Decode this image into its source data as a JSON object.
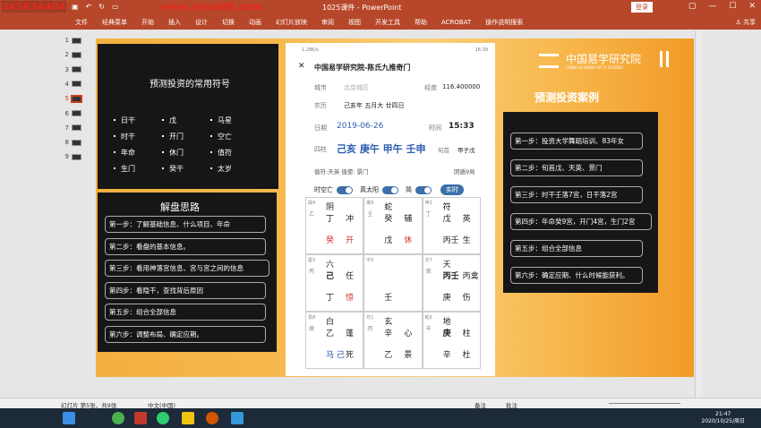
{
  "watermark": {
    "left": "345834404",
    "right": "www.yixue88.com"
  },
  "window": {
    "title": "1025课件 - PowerPoint",
    "login": "登录",
    "share": "共享"
  },
  "ribbon": [
    "文件",
    "经典菜单",
    "开始",
    "插入",
    "设计",
    "切换",
    "动画",
    "幻灯片放映",
    "审阅",
    "视图",
    "开发工具",
    "帮助",
    "ACROBAT",
    "操作说明搜索"
  ],
  "thumbs": [
    "1",
    "2",
    "3",
    "4",
    "5",
    "6",
    "7",
    "8",
    "9"
  ],
  "left_panel": {
    "title": "预测投资的常用符号",
    "symbols": [
      "日干",
      "戊",
      "马星",
      "时干",
      "开门",
      "空亡",
      "年命",
      "休门",
      "值符",
      "生门",
      "癸干",
      "太岁"
    ]
  },
  "solve": {
    "title": "解盘思路",
    "steps": [
      "第一步：了解基础信息、什么项目、年命",
      "第二步：看盘的基本信息。",
      "第三步：看用神落宫信息、宫与宫之间的信息",
      "第四步：看隐干，查找背后原因",
      "第五步：组合全部信息",
      "第六步：调整布局、确定应期。"
    ]
  },
  "phone": {
    "statusbar": "1.28K/s",
    "time": "16:39",
    "title": "中国易学研究院-陈氏九推奇门",
    "city_label": "城市",
    "city_value": "北京城区",
    "lng_label": "经度",
    "lng_value": "116.400000",
    "lunar_label": "农历",
    "lunar_value": "己亥年 五月大 廿四日",
    "date_label": "日期",
    "date_value": "2019-06-26",
    "time_label": "时间",
    "time_value": "15:33",
    "pillar_label": "四柱",
    "pillar_value": "己亥 庚午 甲午 壬申",
    "xun_label": "旬首",
    "xun_value": "甲子戊",
    "zhifu": "值符:天英 值使: 景门",
    "ju": "阴遁9局",
    "opt1": "时空亡",
    "opt2": "真太阳",
    "opt3": "简",
    "realtime": "实时",
    "grid": [
      {
        "pos": "巽4",
        "stem": "乙",
        "deity": "阴",
        "l2a": "丁",
        "l2b": "冲",
        "l3a": "癸",
        "l3b": "开"
      },
      {
        "pos": "离9",
        "stem": "壬",
        "deity": "蛇",
        "l2a": "癸",
        "l2b": "辅",
        "l3a": "戊",
        "l3b": "休"
      },
      {
        "pos": "坤2",
        "stem": "丁",
        "deity": "符",
        "l2a": "戊",
        "l2b": "英",
        "l3a": "丙壬",
        "l3b": "生"
      },
      {
        "pos": "震3",
        "stem": "丙",
        "deity": "六",
        "l2a": "己",
        "l2b": "任",
        "l3a": "丁",
        "l3b": "惊"
      },
      {
        "pos": "中5",
        "stem": "",
        "deity": "",
        "l2a": "",
        "l2b": "",
        "l3a": "壬",
        "l3b": ""
      },
      {
        "pos": "兑7",
        "stem": "癸",
        "deity": "天",
        "l2a": "丙壬",
        "l2b": "丙禽",
        "l3a": "庚",
        "l3b": "伤"
      },
      {
        "pos": "艮8",
        "stem": "庚",
        "deity": "白",
        "l2a": "乙",
        "l2b": "蓬",
        "l3a": "马 己",
        "l3b": "死"
      },
      {
        "pos": "坎1",
        "stem": "丙",
        "deity": "玄",
        "l2a": "辛",
        "l2b": "心",
        "l3a": "乙",
        "l3b": "景"
      },
      {
        "pos": "乾6",
        "stem": "辛",
        "deity": "地",
        "l2a": "庚",
        "l2b": "柱",
        "l3a": "辛",
        "l3b": "杜"
      }
    ]
  },
  "brand": {
    "name": "中国易学研究院",
    "sub": "CHINA ACADEMY OF YI STUDIES"
  },
  "cases": {
    "title": "预测投资案例",
    "steps": [
      "第一步：投资大学舞蹈培训、83年女",
      "第二步：旬首戊、天英、景门",
      "第三步：时干壬落7宫，日干落2宫",
      "第四步：年命癸9宫，开门4宫，生门2宫",
      "第五步：组合全部信息",
      "第六步：确定应期、什么时候能获利。"
    ]
  },
  "status": {
    "left": "幻灯片 第5张，共9张",
    "lang": "中文(中国)",
    "notes": "备注",
    "comments": "批注",
    "zoom": "+"
  },
  "taskbar": {
    "time": "21:47",
    "date": "2020/10/25/周日"
  }
}
